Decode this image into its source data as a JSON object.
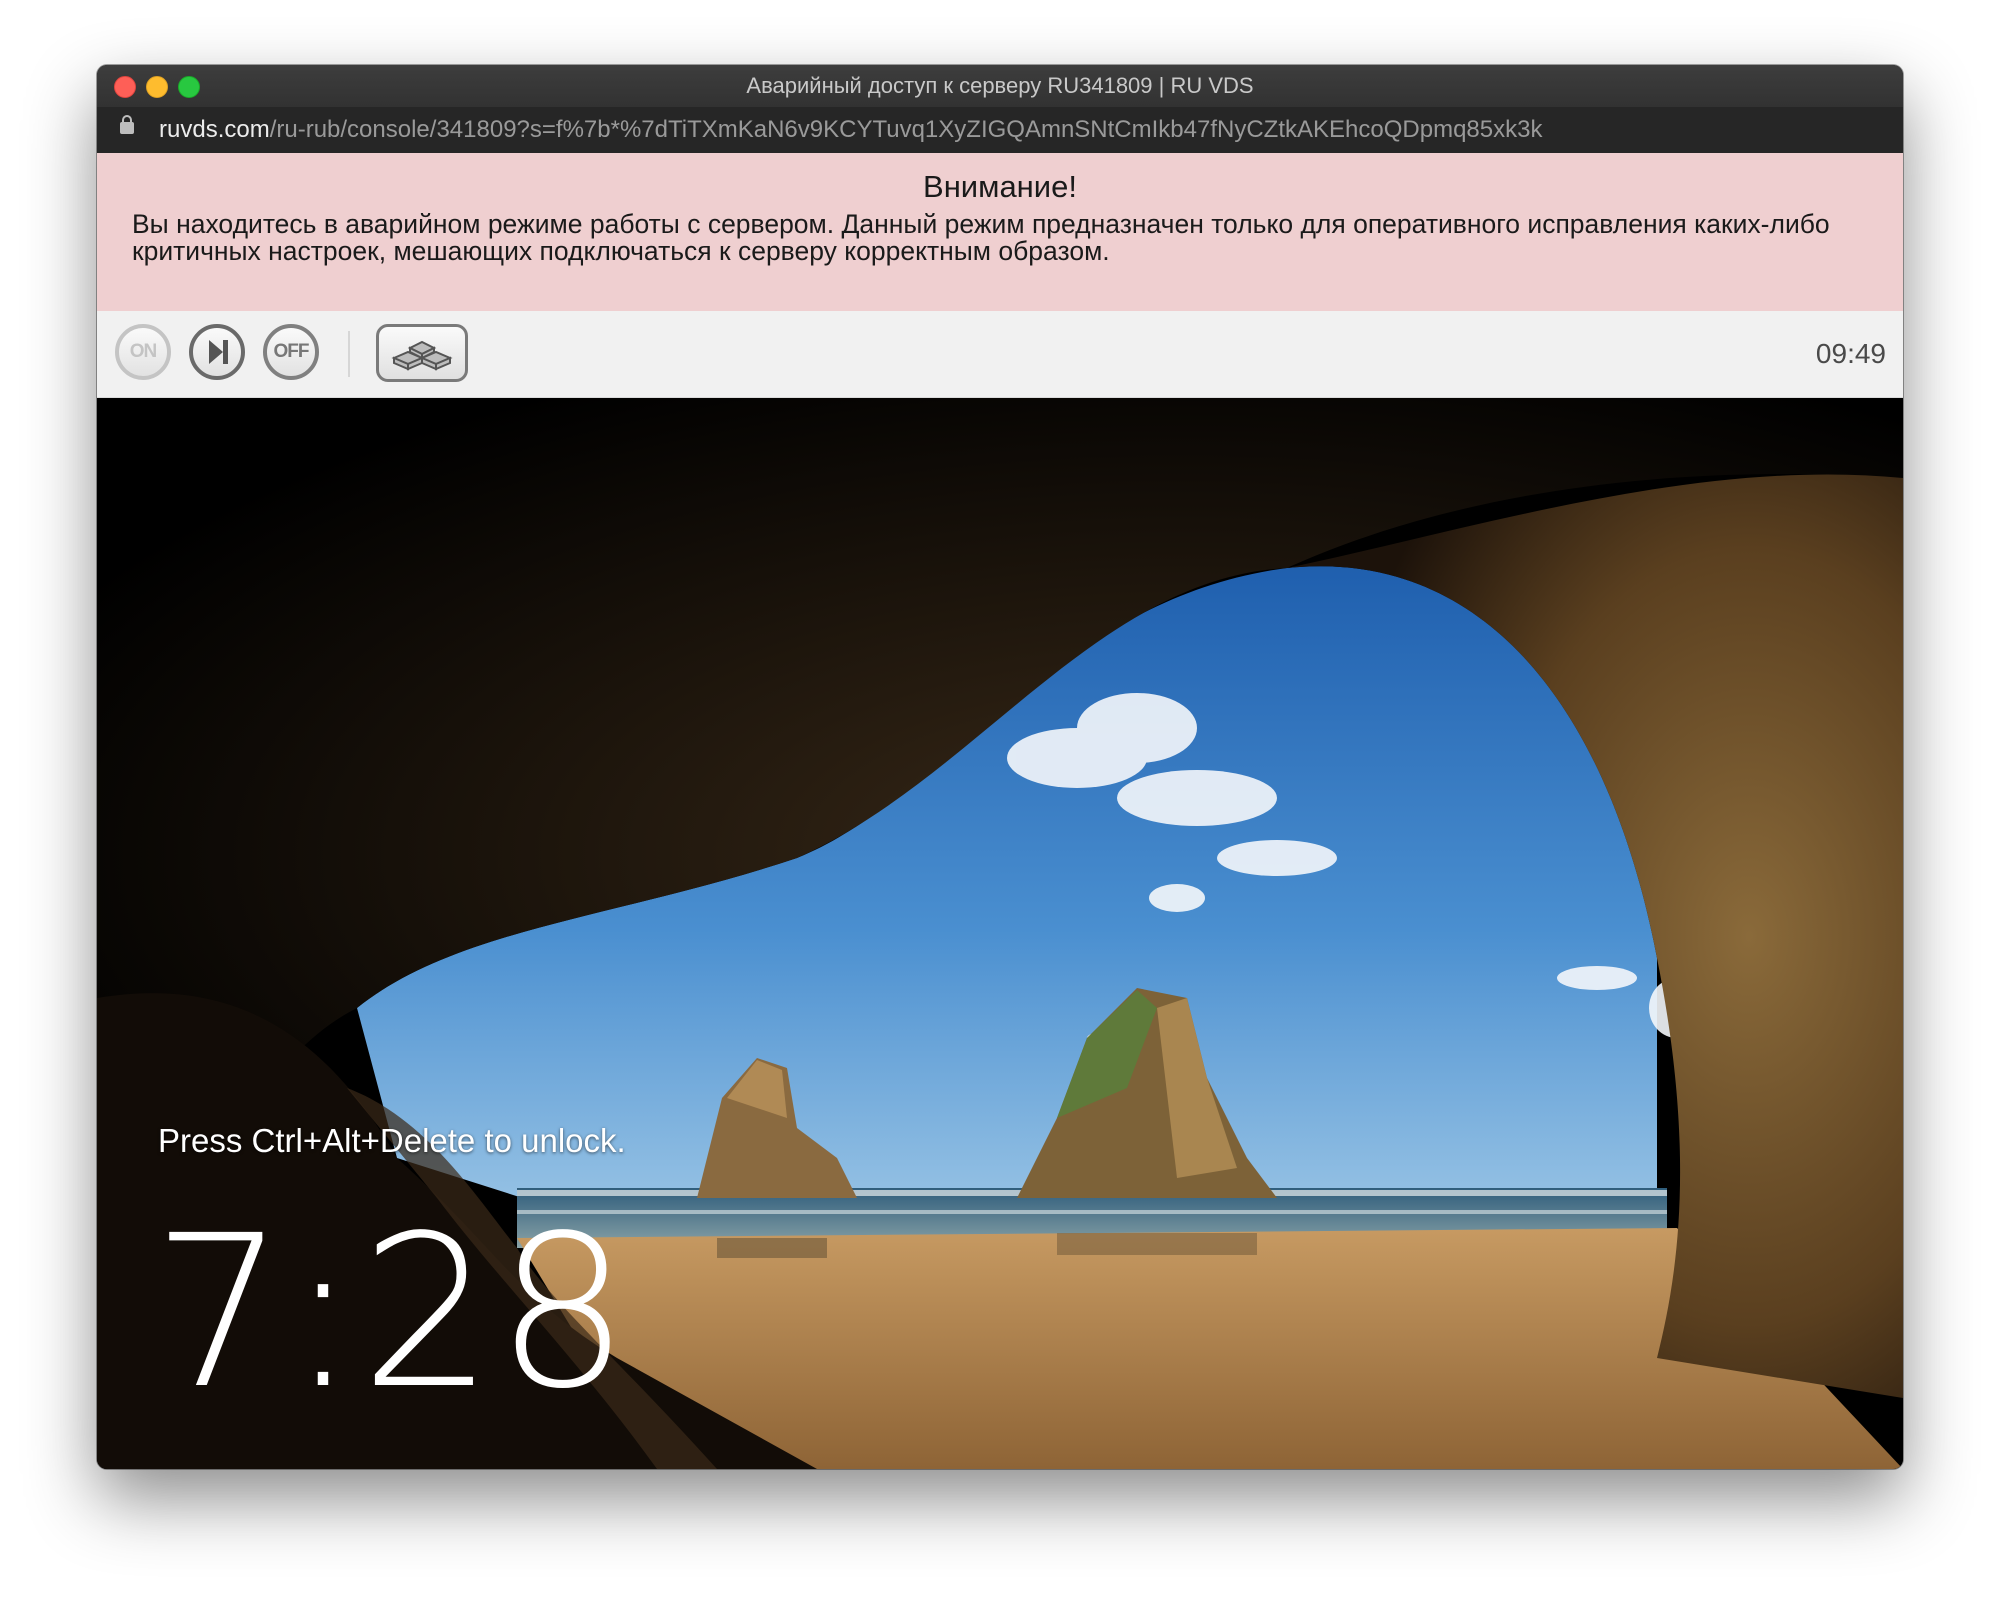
{
  "window": {
    "title": "Аварийный доступ к серверу RU341809 | RU VDS"
  },
  "address_bar": {
    "host": "ruvds.com",
    "path": "/ru-rub/console/341809?s=f%7b*%7dTiTXmKaN6v9KCYTuvq1XyZIGQAmnSNtCmIkb47fNyCZtkAKEhcoQDpmq85xk3k",
    "icon": "lock-icon"
  },
  "banner": {
    "title": "Внимание!",
    "text": "Вы находитесь в аварийном режиме работы с сервером. Данный режим предназначен только для оперативного исправления каких-либо критичных настроек, мешающих подключаться к серверу корректным образом."
  },
  "toolbar": {
    "on_label": "ON",
    "off_label": "OFF",
    "reset_icon": "reset-icon",
    "cad_icon": "ctrl-alt-del-icon",
    "clock": "09:49"
  },
  "lockscreen": {
    "message": "Press Ctrl+Alt+Delete to unlock.",
    "time": "7:28"
  },
  "colors": {
    "banner_bg": "#efcfd0",
    "toolbar_bg": "#f1f1f1",
    "titlebar_bg": "#363636",
    "urlbar_bg": "#262626"
  }
}
